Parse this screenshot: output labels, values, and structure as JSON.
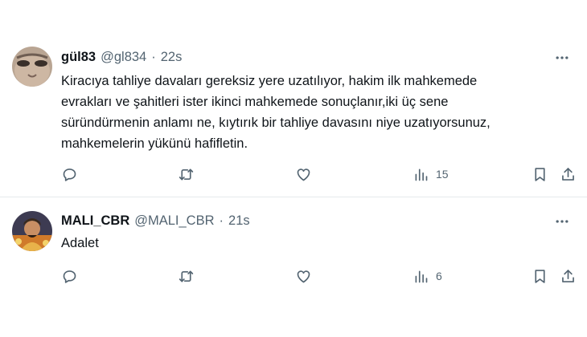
{
  "tweets": [
    {
      "display_name": "gül83",
      "handle": "@gl834",
      "separator": "·",
      "time": "22s",
      "text_lines": [
        "Kiracıya tahliye davaları gereksiz yere uzatılıyor, hakim ilk mahkemede",
        "evrakları ve şahitleri ister ikinci mahkemede sonuçlanır,iki üç sene",
        "süründürmenin anlamı ne, kıytırık bir tahliye davasını  niye uzatıyorsunuz,",
        "mahkemelerin yükünü hafifletin."
      ],
      "views": "15",
      "icons": [
        "reply-icon",
        "retweet-icon",
        "like-icon",
        "views-icon",
        "bookmark-icon",
        "share-icon",
        "more-icon"
      ]
    },
    {
      "display_name": "MALI_CBR",
      "handle": "@MALI_CBR",
      "separator": "·",
      "time": "21s",
      "text_lines": [
        "Adalet"
      ],
      "views": "6",
      "icons": [
        "reply-icon",
        "retweet-icon",
        "like-icon",
        "views-icon",
        "bookmark-icon",
        "share-icon",
        "more-icon"
      ]
    }
  ],
  "colors": {
    "text": "#0f1419",
    "secondary": "#536471",
    "divider": "#e6e9ec"
  }
}
